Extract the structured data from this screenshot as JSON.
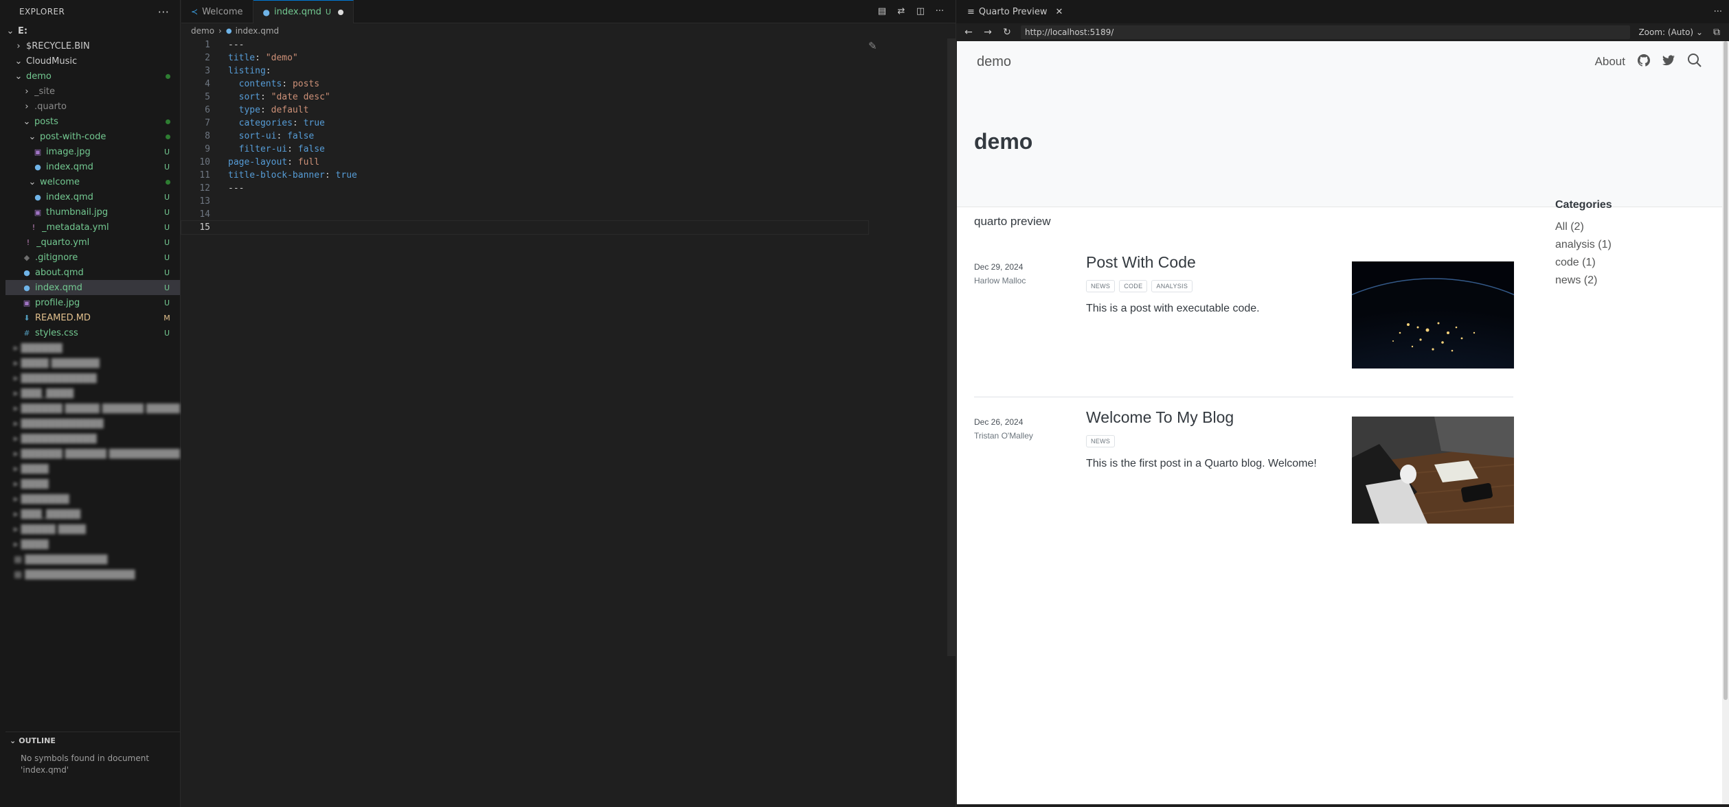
{
  "sidebar": {
    "title": "EXPLORER",
    "root": "E:",
    "tree": [
      {
        "label": "$RECYCLE.BIN",
        "git": ""
      },
      {
        "label": "CloudMusic",
        "git": ""
      },
      {
        "label": "demo",
        "git": ""
      },
      {
        "label": "_site",
        "git": ""
      },
      {
        "label": ".quarto",
        "git": ""
      },
      {
        "label": "posts",
        "git": ""
      },
      {
        "label": "post-with-code",
        "git": ""
      },
      {
        "label": "image.jpg",
        "git": "U"
      },
      {
        "label": "index.qmd",
        "git": "U"
      },
      {
        "label": "welcome",
        "git": ""
      },
      {
        "label": "index.qmd",
        "git": "U"
      },
      {
        "label": "thumbnail.jpg",
        "git": "U"
      },
      {
        "label": "_metadata.yml",
        "git": "U"
      },
      {
        "label": "_quarto.yml",
        "git": "U"
      },
      {
        "label": ".gitignore",
        "git": "U"
      },
      {
        "label": "about.qmd",
        "git": "U"
      },
      {
        "label": "index.qmd",
        "git": "U"
      },
      {
        "label": "profile.jpg",
        "git": "U"
      },
      {
        "label": "REAMED.MD",
        "git": "M"
      },
      {
        "label": "styles.css",
        "git": "U"
      }
    ],
    "outline": {
      "title": "OUTLINE",
      "message": "No symbols found in document 'index.qmd'"
    }
  },
  "editor": {
    "tabs": [
      {
        "label": "Welcome"
      },
      {
        "label": "index.qmd",
        "status": "U"
      }
    ],
    "breadcrumb": [
      "demo",
      "index.qmd"
    ],
    "lines": [
      {
        "n": "1",
        "text": "---"
      },
      {
        "n": "2",
        "key": "title",
        "val": "\"demo\""
      },
      {
        "n": "3",
        "key": "listing",
        "val": ""
      },
      {
        "n": "4",
        "key": "  contents",
        "val": "posts"
      },
      {
        "n": "5",
        "key": "  sort",
        "val": "\"date desc\""
      },
      {
        "n": "6",
        "key": "  type",
        "val": "default"
      },
      {
        "n": "7",
        "key": "  categories",
        "val": "true"
      },
      {
        "n": "8",
        "key": "  sort-ui",
        "val": "false"
      },
      {
        "n": "9",
        "key": "  filter-ui",
        "val": "false"
      },
      {
        "n": "10",
        "key": "page-layout",
        "val": "full"
      },
      {
        "n": "11",
        "key": "title-block-banner",
        "val": "true"
      },
      {
        "n": "12",
        "text": "---"
      },
      {
        "n": "13",
        "text": ""
      },
      {
        "n": "14",
        "text": ""
      },
      {
        "n": "15",
        "text": ""
      }
    ]
  },
  "preview": {
    "tab_title": "Quarto Preview",
    "url": "http://localhost:5189/",
    "zoom": "Zoom: (Auto)",
    "site": {
      "brand": "demo",
      "nav_about": "About",
      "page_title": "demo",
      "listing_desc": "quarto preview",
      "posts": [
        {
          "date": "Dec 29, 2024",
          "author": "Harlow Malloc",
          "title": "Post With Code",
          "categories": [
            "NEWS",
            "CODE",
            "ANALYSIS"
          ],
          "summary": "This is a post with executable code."
        },
        {
          "date": "Dec 26, 2024",
          "author": "Tristan O'Malley",
          "title": "Welcome To My Blog",
          "categories": [
            "NEWS"
          ],
          "summary": "This is the first post in a Quarto blog. Welcome!"
        }
      ],
      "categories_title": "Categories",
      "categories": [
        "All (2)",
        "analysis (1)",
        "code (1)",
        "news (2)"
      ]
    }
  }
}
